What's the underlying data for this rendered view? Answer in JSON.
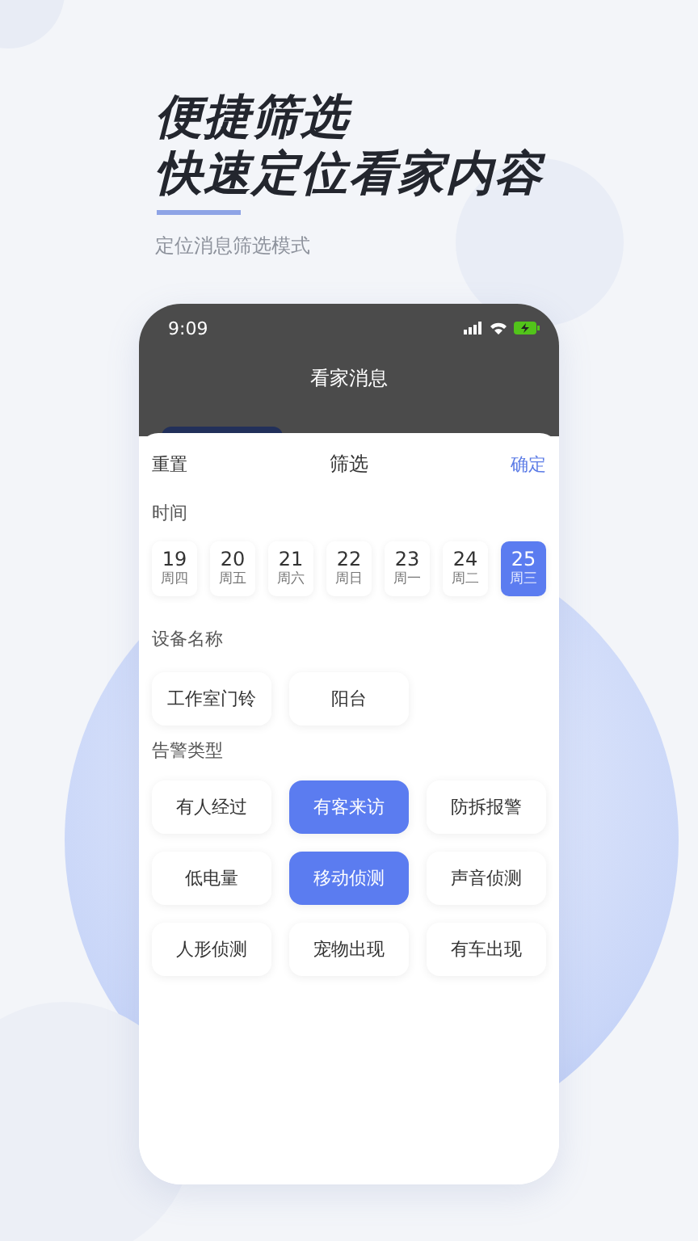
{
  "headline": [
    "便捷筛选",
    "快速定位看家内容"
  ],
  "subtitle": "定位消息筛选模式",
  "phone": {
    "status_time": "9:09",
    "title": "看家消息",
    "sheet": {
      "reset": "重置",
      "title": "筛选",
      "confirm": "确定",
      "time_label": "时间",
      "dates": [
        {
          "day": "19",
          "weekday": "周四",
          "selected": false
        },
        {
          "day": "20",
          "weekday": "周五",
          "selected": false
        },
        {
          "day": "21",
          "weekday": "周六",
          "selected": false
        },
        {
          "day": "22",
          "weekday": "周日",
          "selected": false
        },
        {
          "day": "23",
          "weekday": "周一",
          "selected": false
        },
        {
          "day": "24",
          "weekday": "周二",
          "selected": false
        },
        {
          "day": "25",
          "weekday": "周三",
          "selected": true
        }
      ],
      "device_label": "设备名称",
      "devices": [
        {
          "label": "工作室门铃",
          "selected": false
        },
        {
          "label": "阳台",
          "selected": false
        }
      ],
      "alert_label": "告警类型",
      "alerts": [
        {
          "label": "有人经过",
          "selected": false
        },
        {
          "label": "有客来访",
          "selected": true
        },
        {
          "label": "防拆报警",
          "selected": false
        },
        {
          "label": "低电量",
          "selected": false
        },
        {
          "label": "移动侦测",
          "selected": true
        },
        {
          "label": "声音侦测",
          "selected": false
        },
        {
          "label": "人形侦测",
          "selected": false
        },
        {
          "label": "宠物出现",
          "selected": false
        },
        {
          "label": "有车出现",
          "selected": false
        }
      ]
    }
  }
}
